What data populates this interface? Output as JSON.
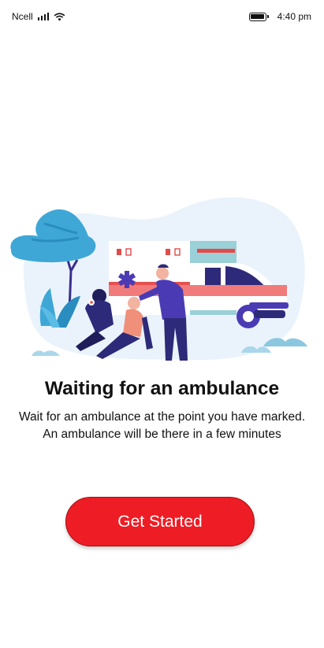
{
  "status_bar": {
    "carrier": "Ncell",
    "time": "4:40 pm",
    "icons": [
      "signal-icon",
      "wifi-icon",
      "battery-icon"
    ]
  },
  "illustration": {
    "name": "paramedics-ambulance-illustration"
  },
  "content": {
    "title": "Waiting for an ambulance",
    "description_line1": "Wait for an ambulance at the point you have marked.",
    "description_line2": "An ambulance will be there in a few minutes"
  },
  "actions": {
    "get_started_label": "Get Started"
  },
  "colors": {
    "primary": "#ee1c24",
    "illustration_blue": "#3fa7d6",
    "illustration_navy": "#2d2a7a",
    "illustration_purple": "#4a3bb5"
  }
}
